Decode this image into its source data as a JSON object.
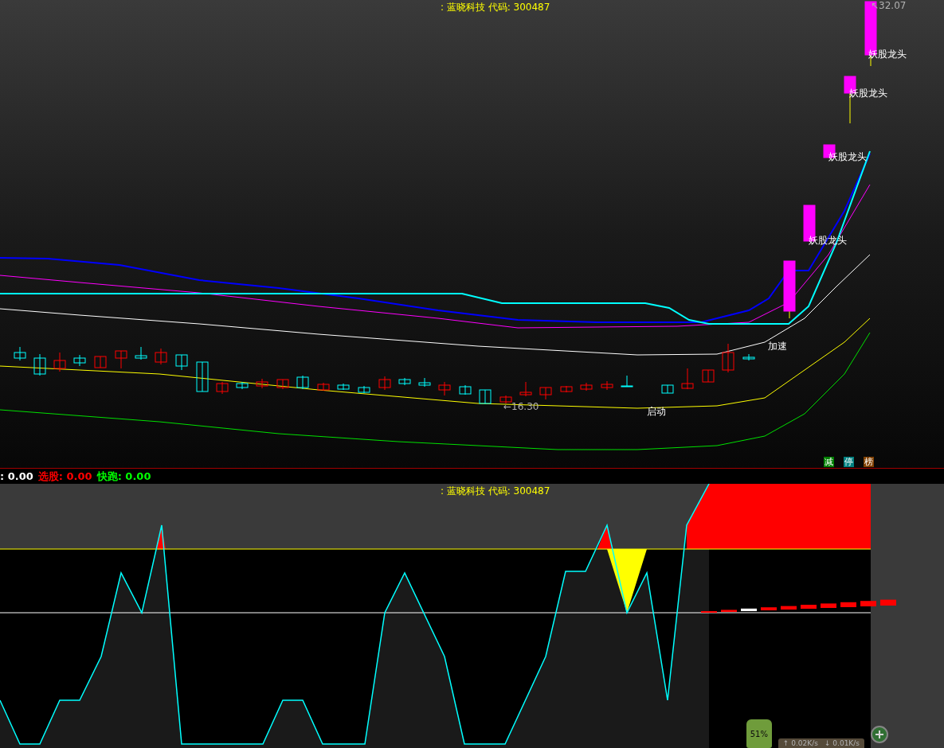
{
  "upper_chart": {
    "title": ": 蓝晓科技 代码: 300487",
    "annotations": [
      {
        "kind": "signal",
        "text": "妖股龙头"
      },
      {
        "kind": "signal",
        "text": "妖股龙头"
      },
      {
        "kind": "signal",
        "text": "妖股龙头"
      },
      {
        "kind": "signal",
        "text": "妖股龙头"
      },
      {
        "kind": "signal",
        "text": "加速"
      },
      {
        "kind": "signal",
        "text": "启动"
      },
      {
        "kind": "price",
        "text": "←16.30"
      },
      {
        "kind": "price",
        "text": "↖32.07"
      }
    ],
    "tags": [
      {
        "text": "减",
        "color": "#008000"
      },
      {
        "text": "停",
        "color": "#008080"
      },
      {
        "text": "榜",
        "color": "#804000"
      }
    ]
  },
  "legend": [
    {
      "value": ": 0.00",
      "color": "#ffffff"
    },
    {
      "label": "选股",
      "value": ": 0.00",
      "color": "#ff0000"
    },
    {
      "label": "快跑",
      "value": ": 0.00",
      "color": "#00ff00"
    }
  ],
  "lower_chart": {
    "title": ": 蓝晓科技 代码: 300487"
  },
  "gadget": {
    "percent": "51%",
    "upload": "↑ 0.02K/s",
    "download": "↓ 0.01K/s"
  }
}
